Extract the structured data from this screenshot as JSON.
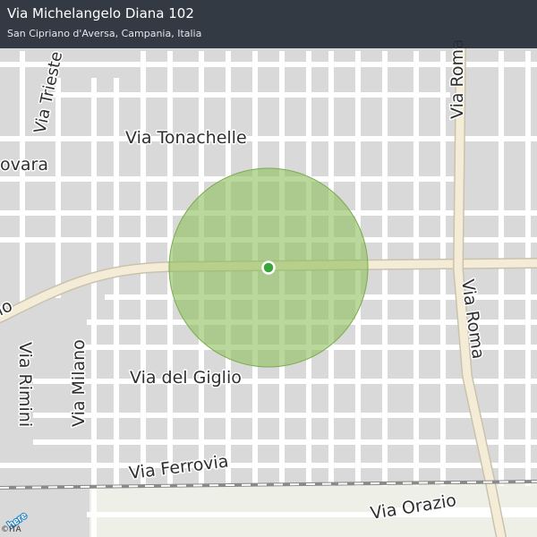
{
  "header": {
    "title": "Via Michelangelo Diana 102",
    "subtitle": "San Cipriano d'Aversa, Campania, Italia"
  },
  "streets": [
    {
      "id": "via-trieste",
      "label": "Via Trieste"
    },
    {
      "id": "via-tonachelle",
      "label": "Via Tonachelle"
    },
    {
      "id": "via-roma-north",
      "label": "Via Roma"
    },
    {
      "id": "via-novara",
      "label": "ovara"
    },
    {
      "id": "via-roma-south",
      "label": "Via Roma"
    },
    {
      "id": "via-rimini",
      "label": "Via Rimini"
    },
    {
      "id": "via-milano",
      "label": "Via Milano"
    },
    {
      "id": "via-del-giglio",
      "label": "Via del Giglio"
    },
    {
      "id": "via-ferrovia",
      "label": "Via Ferrovia"
    },
    {
      "id": "via-orazio",
      "label": "Via Orazio"
    },
    {
      "id": "via-left-edge",
      "label": "io"
    }
  ],
  "location_marker": {
    "color": "#3aa53a",
    "radius_color": "#8fbf5f"
  },
  "branding": {
    "logo": "here",
    "copyright": "©ITA"
  },
  "colors": {
    "background": "#d9d9d9",
    "road": "#ffffff",
    "main_road": "#f4ecd6",
    "railway": "#8a8a8a"
  }
}
